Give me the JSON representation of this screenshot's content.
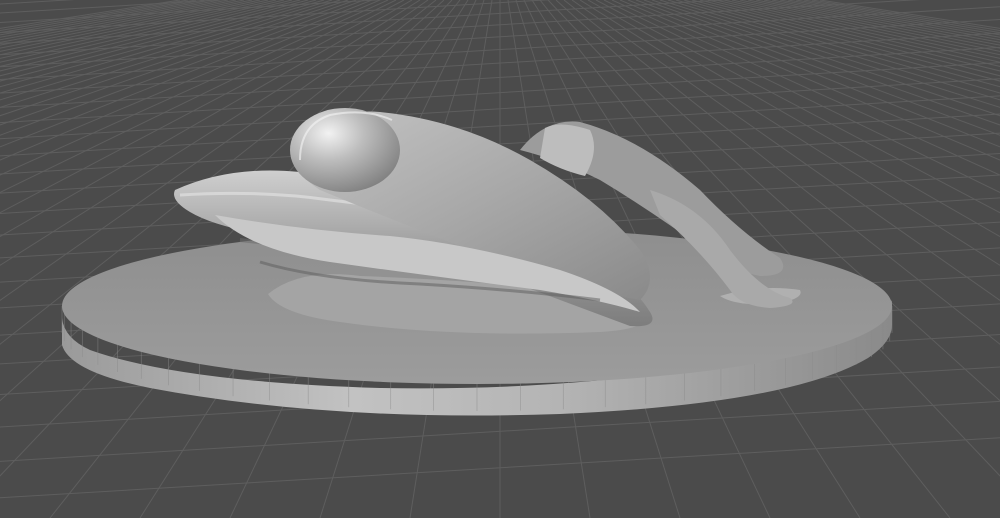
{
  "viewport": {
    "background_color": "#4b4b4b",
    "grid_color": "#5e5e5e",
    "model_color": "#b4b4b4",
    "base_color": "#9a9a9a",
    "shadow_color": "#6a6a6a",
    "highlight_color": "#e6e6e6",
    "icons": [
      "grid-floor",
      "sculpt-model",
      "round-base"
    ]
  }
}
